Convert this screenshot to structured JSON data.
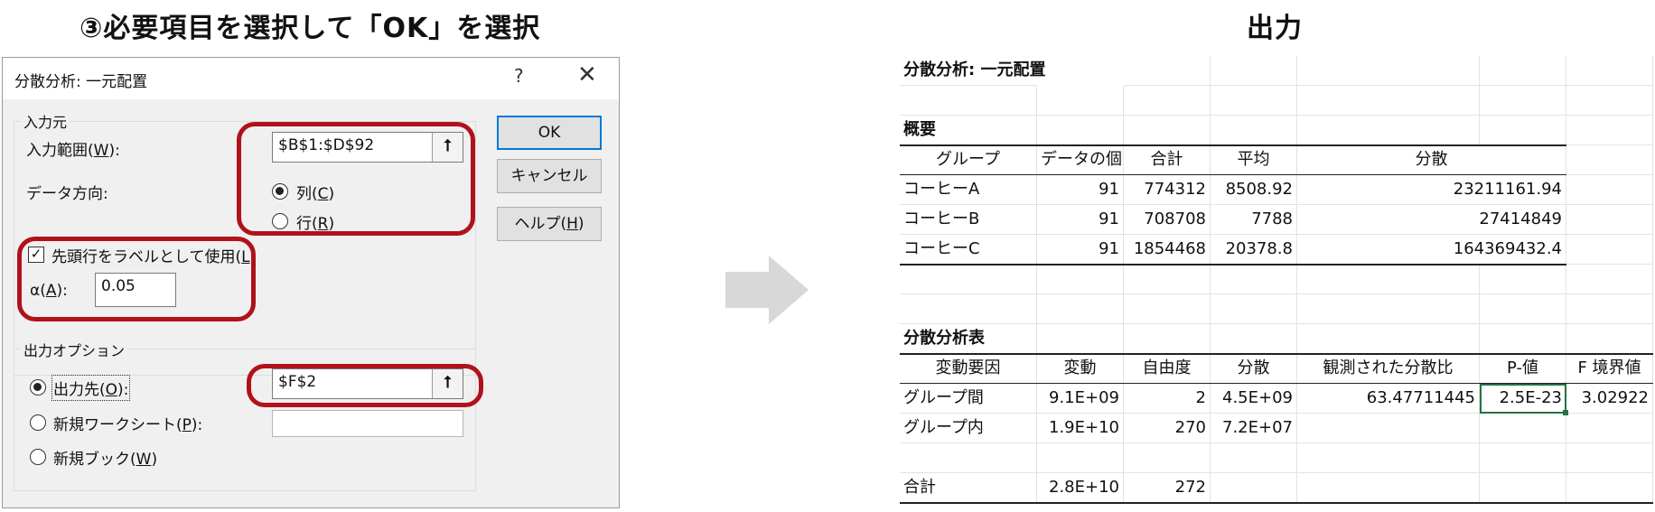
{
  "headings": {
    "left": "③必要項目を選択して「OK」を選択",
    "right": "出力"
  },
  "dialog": {
    "title": "分散分析: 一元配置",
    "help_glyph": "?",
    "close_glyph": "✕",
    "input_group": "入力元",
    "input_range_label": "入力範囲(",
    "input_range_key": "W",
    "input_range_suffix": "):",
    "input_range_value": "$B$1:$D$92",
    "direction_label": "データ方向:",
    "radio_columns_label": "列(",
    "radio_columns_key": "C",
    "radio_rows_label": "行(",
    "radio_rows_key": "R",
    "close_paren": ")",
    "labels_checkbox": "先頭行をラベルとして使用(",
    "labels_checkbox_key": "L",
    "alpha_label": "α(",
    "alpha_key": "A",
    "alpha_suffix": "):",
    "alpha_value": "0.05",
    "output_group": "出力オプション",
    "output_range_label": "出力先(",
    "output_range_key": "O",
    "output_range_suffix": "):",
    "output_range_value": "$F$2",
    "new_sheet_label": "新規ワークシート(",
    "new_sheet_key": "P",
    "new_sheet_suffix": "):",
    "new_book_label": "新規ブック(",
    "new_book_key": "W",
    "ok": "OK",
    "cancel": "キャンセル",
    "help_label": "ヘルプ(",
    "help_key": "H",
    "ref_icon_glyph": "⭡",
    "columns_selected": true,
    "labels_checked": true,
    "output_selected": "出力先"
  },
  "colors": {
    "highlight": "#b0121b",
    "dialog_bg": "#f0f0f0",
    "primary_border": "#0078d7",
    "selection": "#217346",
    "arrow": "#d8d8d8"
  },
  "sheet": {
    "title": "分散分析: 一元配置",
    "summary_title": "概要",
    "summary_headers": [
      "グループ",
      "データの個数",
      "合計",
      "平均",
      "分散"
    ],
    "summary_rows": [
      [
        "コーヒーA",
        "91",
        "774312",
        "8508.92",
        "23211161.94"
      ],
      [
        "コーヒーB",
        "91",
        "708708",
        "7788",
        "27414849"
      ],
      [
        "コーヒーC",
        "91",
        "1854468",
        "20378.8",
        "164369432.4"
      ]
    ],
    "anova_title": "分散分析表",
    "anova_headers": [
      "変動要因",
      "変動",
      "自由度",
      "分散",
      "観測された分散比",
      "P-値",
      "F 境界値"
    ],
    "anova_rows": [
      [
        "グループ間",
        "9.1E+09",
        "2",
        "4.5E+09",
        "63.47711445",
        "2.5E-23",
        "3.02922"
      ],
      [
        "グループ内",
        "1.9E+10",
        "270",
        "7.2E+07",
        "",
        "",
        ""
      ]
    ],
    "anova_total": [
      "合計",
      "2.8E+10",
      "272",
      "",
      "",
      "",
      ""
    ]
  }
}
